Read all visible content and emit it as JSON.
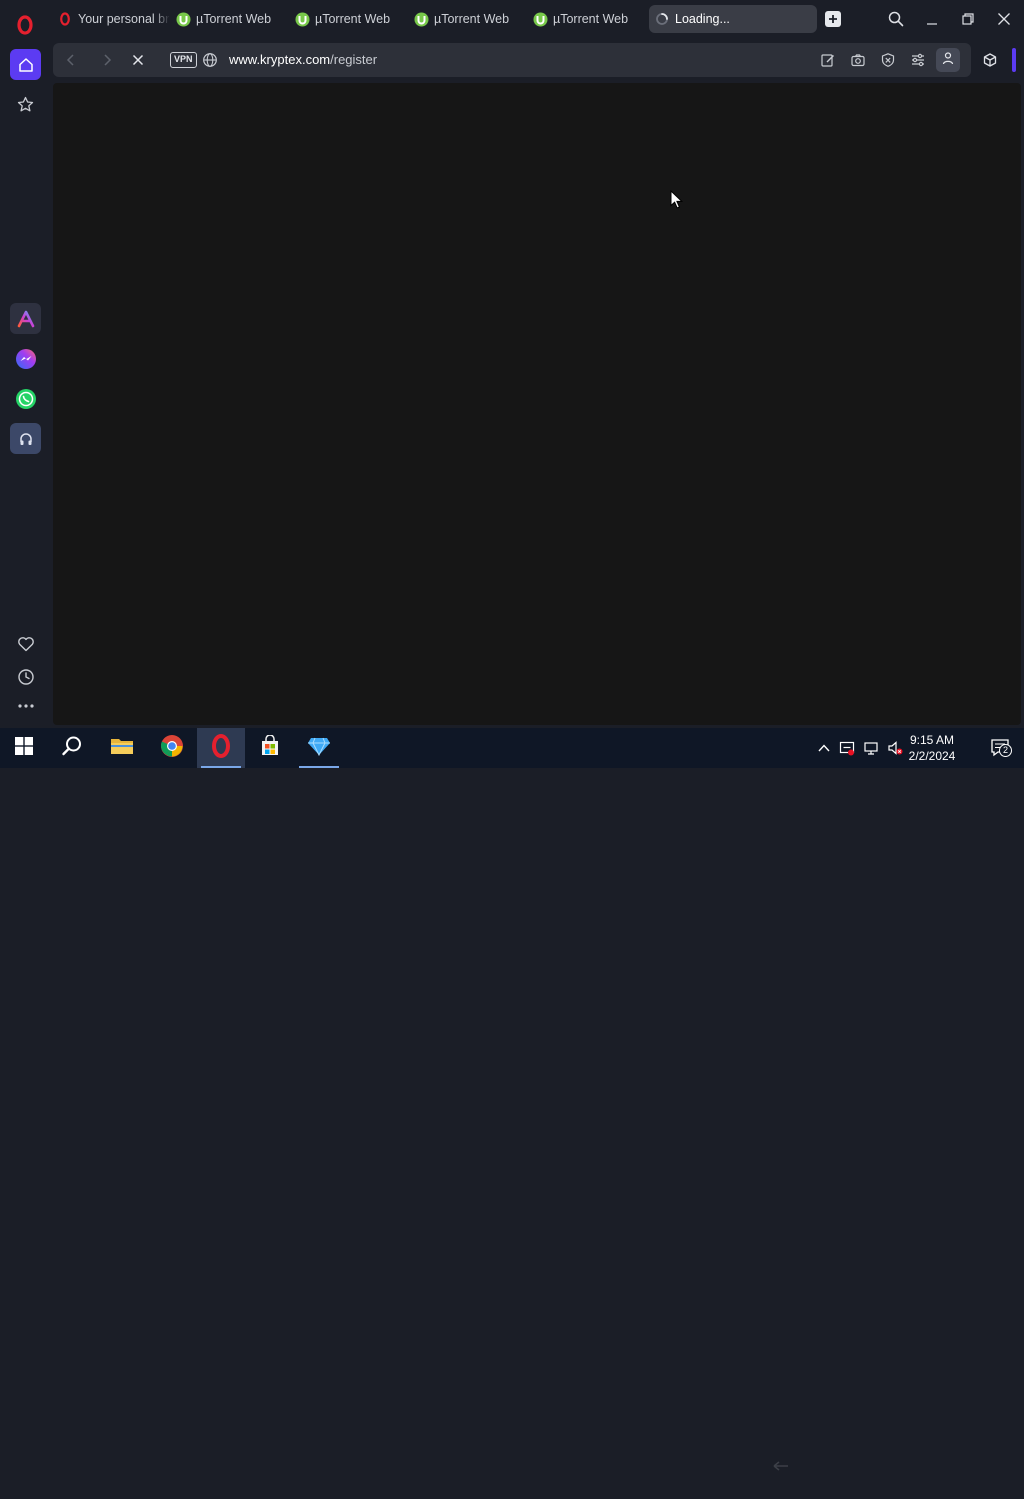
{
  "browser": {
    "tabs": [
      {
        "label": "Your personal br",
        "icon": "opera-icon"
      },
      {
        "label": "µTorrent Web",
        "icon": "utorrent-icon"
      },
      {
        "label": "µTorrent Web",
        "icon": "utorrent-icon"
      },
      {
        "label": "µTorrent Web",
        "icon": "utorrent-icon"
      },
      {
        "label": "µTorrent Web",
        "icon": "utorrent-icon"
      },
      {
        "label": "Loading...",
        "icon": "spinner-icon",
        "active": true
      }
    ],
    "address": {
      "vpn_label": "VPN",
      "url_host": "www.kryptex.com",
      "url_path": "/register"
    }
  },
  "sidebar": {
    "items": [
      "home-icon",
      "star-icon",
      "aria-icon",
      "messenger-icon",
      "whatsapp-icon",
      "music-player-icon",
      "heart-icon",
      "history-icon",
      "more-icon"
    ]
  },
  "taskbar": {
    "apps": [
      "start-icon",
      "search-icon",
      "file-explorer-icon",
      "chrome-icon",
      "opera-icon",
      "microsoft-store-icon",
      "kryptex-icon"
    ],
    "time": "9:15 AM",
    "date": "2/2/2024",
    "notification_count": "2"
  },
  "colors": {
    "accent": "#5c3bf2",
    "background": "#1b1e27",
    "page": "#161616"
  }
}
